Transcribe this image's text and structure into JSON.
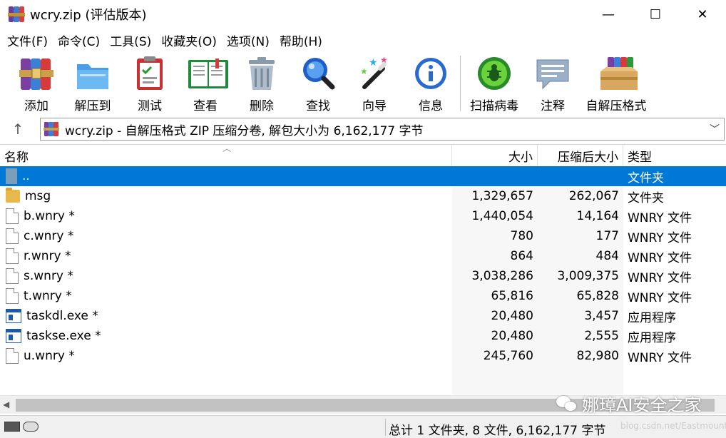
{
  "window": {
    "title": "wcry.zip (评估版本)",
    "controls": [
      "—",
      "☐",
      "✕"
    ]
  },
  "menu": [
    "文件(F)",
    "命令(C)",
    "工具(S)",
    "收藏夹(O)",
    "选项(N)",
    "帮助(H)"
  ],
  "toolbar": [
    {
      "label": "添加",
      "icon": "add-archive-icon"
    },
    {
      "label": "解压到",
      "icon": "extract-to-icon"
    },
    {
      "label": "测试",
      "icon": "test-icon"
    },
    {
      "label": "查看",
      "icon": "view-icon"
    },
    {
      "label": "删除",
      "icon": "delete-icon"
    },
    {
      "label": "查找",
      "icon": "find-icon"
    },
    {
      "label": "向导",
      "icon": "wizard-icon"
    },
    {
      "label": "信息",
      "icon": "info-icon"
    },
    {
      "label": "扫描病毒",
      "icon": "virus-scan-icon"
    },
    {
      "label": "注释",
      "icon": "comment-icon"
    },
    {
      "label": "自解压格式",
      "icon": "sfx-icon"
    }
  ],
  "address": {
    "text": "wcry.zip - 自解压格式 ZIP 压缩分卷, 解包大小为 6,162,177 字节"
  },
  "columns": {
    "name": "名称",
    "size": "大小",
    "packed": "压缩后大小",
    "type": "类型"
  },
  "files": [
    {
      "name": "..",
      "size": "",
      "packed": "",
      "type": "文件夹",
      "icon": "up-folder",
      "selected": true
    },
    {
      "name": "msg",
      "size": "1,329,657",
      "packed": "262,067",
      "type": "文件夹",
      "icon": "folder"
    },
    {
      "name": "b.wnry *",
      "size": "1,440,054",
      "packed": "14,164",
      "type": "WNRY 文件",
      "icon": "file"
    },
    {
      "name": "c.wnry *",
      "size": "780",
      "packed": "177",
      "type": "WNRY 文件",
      "icon": "file"
    },
    {
      "name": "r.wnry *",
      "size": "864",
      "packed": "484",
      "type": "WNRY 文件",
      "icon": "file"
    },
    {
      "name": "s.wnry *",
      "size": "3,038,286",
      "packed": "3,009,375",
      "type": "WNRY 文件",
      "icon": "file"
    },
    {
      "name": "t.wnry *",
      "size": "65,816",
      "packed": "65,828",
      "type": "WNRY 文件",
      "icon": "file"
    },
    {
      "name": "taskdl.exe *",
      "size": "20,480",
      "packed": "3,457",
      "type": "应用程序",
      "icon": "exe"
    },
    {
      "name": "taskse.exe *",
      "size": "20,480",
      "packed": "2,555",
      "type": "应用程序",
      "icon": "exe"
    },
    {
      "name": "u.wnry *",
      "size": "245,760",
      "packed": "82,980",
      "type": "WNRY 文件",
      "icon": "file"
    }
  ],
  "status": {
    "text": "总计 1 文件夹, 8 文件, 6,162,177 字节"
  },
  "watermark": {
    "text": "娜璋AI安全之家",
    "url": "blog.csdn.net/Eastmount"
  },
  "colors": {
    "selection": "#0078d7"
  }
}
